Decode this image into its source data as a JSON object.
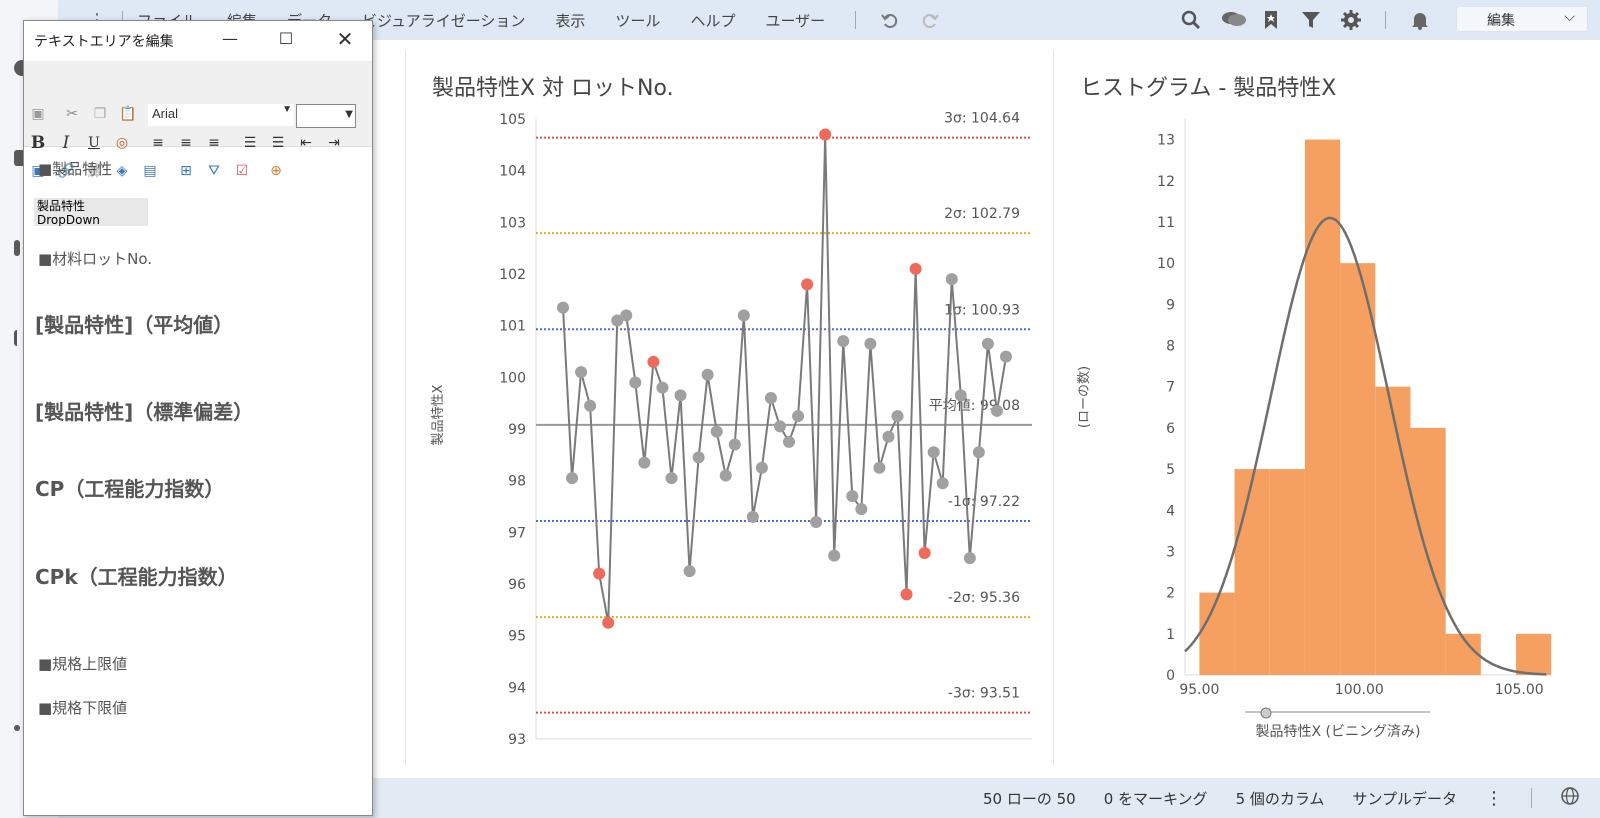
{
  "menubar": {
    "items": [
      "ファイル",
      "編集",
      "データ",
      "ビジュアライゼーション",
      "表示",
      "ツール",
      "ヘルプ",
      "ユーザー"
    ],
    "edit_dropdown": "編集"
  },
  "dialog": {
    "title": "テキストエリアを編集",
    "font": "Arial",
    "section1": "■製品特性",
    "dropdown_label": "製品特性",
    "dropdown_value": "DropDown",
    "section2": "■材料ロットNo.",
    "big1": "[製品特性]（平均値）",
    "big2": "[製品特性]（標準偏差）",
    "big3": "CP（工程能力指数）",
    "big4": "CPk（工程能力指数）",
    "section3": "■規格上限値",
    "section4": "■規格下限値"
  },
  "status": {
    "rows": "50 ローの 50",
    "marked": "0 をマーキング",
    "columns": "5 個のカラム",
    "dataset": "サンプルデータ"
  },
  "chart_data": [
    {
      "type": "line",
      "title": "製品特性X 対 ロットNo.",
      "ylabel": "製品特性X",
      "xlabel": "",
      "ylim": [
        93,
        105
      ],
      "yticks": [
        93,
        94,
        95,
        96,
        97,
        98,
        99,
        100,
        101,
        102,
        103,
        104,
        105
      ],
      "series": [
        {
          "values": [
            101.35,
            98.05,
            100.1,
            99.45,
            96.2,
            95.25,
            101.1,
            101.2,
            99.9,
            98.35,
            100.3,
            99.8,
            98.05,
            99.65,
            96.25,
            98.45,
            100.05,
            98.95,
            98.1,
            98.7,
            101.2,
            97.3,
            98.25,
            99.6,
            99.05,
            98.75,
            99.25,
            101.8,
            97.2,
            104.7,
            96.55,
            100.7,
            97.7,
            97.45,
            100.65,
            98.25,
            98.85,
            99.25,
            95.8,
            102.1,
            96.6,
            98.55,
            97.95,
            101.9,
            99.65,
            96.5,
            98.55,
            100.65,
            99.35,
            100.4
          ],
          "highlighted_indices": [
            4,
            5,
            10,
            27,
            29,
            38,
            39,
            40
          ]
        }
      ],
      "reference_lines": [
        {
          "label": "3σ: 104.64",
          "value": 104.64,
          "color": "#e05050"
        },
        {
          "label": "2σ: 102.79",
          "value": 102.79,
          "color": "#e0b020"
        },
        {
          "label": "1σ: 100.93",
          "value": 100.93,
          "color": "#4a6fdc"
        },
        {
          "label": "平均値: 99.08",
          "value": 99.08,
          "color": "#999999"
        },
        {
          "label": "-1σ: 97.22",
          "value": 97.22,
          "color": "#4a6fdc"
        },
        {
          "label": "-2σ: 95.36",
          "value": 95.36,
          "color": "#e0b020"
        },
        {
          "label": "-3σ: 93.51",
          "value": 93.51,
          "color": "#e05050"
        }
      ],
      "colors": {
        "point": "#a0a0a0",
        "highlight": "#ee6a5a",
        "line": "#7a7a7a"
      }
    },
    {
      "type": "bar",
      "title": "ヒストグラム - 製品特性X",
      "xlabel": "製品特性X (ビニング済み)",
      "ylabel": "(ローの数)",
      "ylim": [
        0,
        13.5
      ],
      "yticks": [
        0,
        1,
        2,
        3,
        4,
        5,
        6,
        7,
        8,
        9,
        10,
        11,
        12,
        13
      ],
      "xticks": [
        "95.00",
        "100.00",
        "105.00"
      ],
      "xlim": [
        94.55,
        105.9
      ],
      "bins": [
        {
          "start": 95.0,
          "end": 96.1,
          "count": 2
        },
        {
          "start": 96.1,
          "end": 97.2,
          "count": 5
        },
        {
          "start": 97.2,
          "end": 98.3,
          "count": 5
        },
        {
          "start": 98.3,
          "end": 99.4,
          "count": 13
        },
        {
          "start": 99.4,
          "end": 100.5,
          "count": 10
        },
        {
          "start": 100.5,
          "end": 101.6,
          "count": 7
        },
        {
          "start": 101.6,
          "end": 102.7,
          "count": 6
        },
        {
          "start": 102.7,
          "end": 103.8,
          "count": 1
        },
        {
          "start": 103.8,
          "end": 104.9,
          "count": 0
        },
        {
          "start": 104.9,
          "end": 106.0,
          "count": 1
        }
      ],
      "curve": {
        "mean": 99.08,
        "sd": 1.86,
        "peak": 11.1
      },
      "colors": {
        "bar": "#f5a060",
        "curve": "#6e6e6e"
      }
    }
  ]
}
